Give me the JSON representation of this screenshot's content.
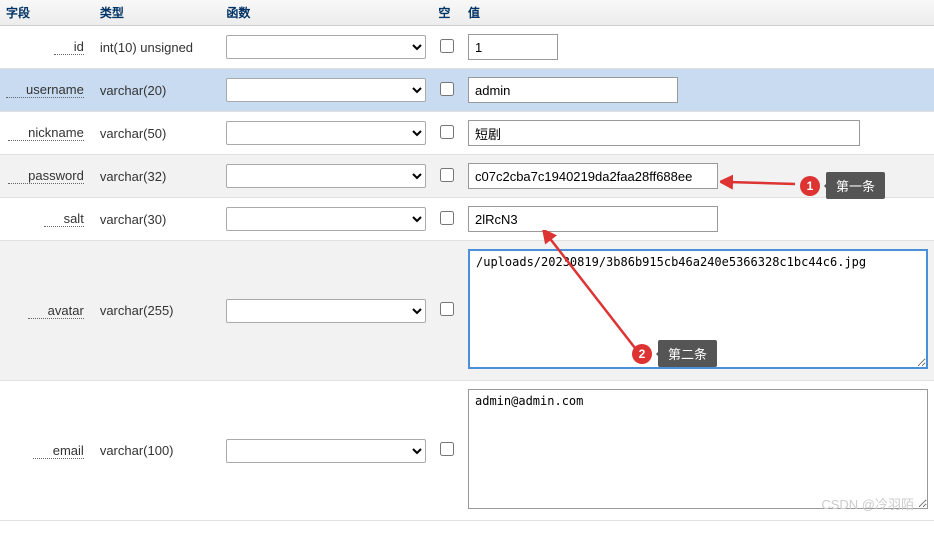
{
  "headers": {
    "field": "字段",
    "type": "类型",
    "func": "函数",
    "null": "空",
    "value": "值"
  },
  "rows": [
    {
      "field": "id",
      "type": "int(10) unsigned",
      "value": "1",
      "width": "w-small",
      "tall": false,
      "kind": "input",
      "style": "row-odd"
    },
    {
      "field": "username",
      "type": "varchar(20)",
      "value": "admin",
      "width": "w-med",
      "tall": false,
      "kind": "input",
      "style": "row-highlight"
    },
    {
      "field": "nickname",
      "type": "varchar(50)",
      "value": "短剧",
      "width": "w-large",
      "tall": false,
      "kind": "input",
      "style": "row-odd"
    },
    {
      "field": "password",
      "type": "varchar(32)",
      "value": "c07c2cba7c1940219da2faa28ff688ee",
      "width": "w-mid",
      "tall": false,
      "kind": "input",
      "style": "row-even"
    },
    {
      "field": "salt",
      "type": "varchar(30)",
      "value": "2lRcN3",
      "width": "w-mid",
      "tall": false,
      "kind": "input",
      "style": "row-odd"
    },
    {
      "field": "avatar",
      "type": "varchar(255)",
      "value": "/uploads/20230819/3b86b915cb46a240e5366328c1bc44c6.jpg",
      "width": "",
      "tall": true,
      "kind": "textarea-focused",
      "style": "row-even"
    },
    {
      "field": "email",
      "type": "varchar(100)",
      "value": "admin@admin.com",
      "width": "",
      "tall": true,
      "kind": "textarea",
      "style": "row-odd"
    }
  ],
  "annotations": {
    "a1": {
      "num": "1",
      "label": "第一条"
    },
    "a2": {
      "num": "2",
      "label": "第二条"
    }
  },
  "watermark": "CSDN @冷羽陌"
}
